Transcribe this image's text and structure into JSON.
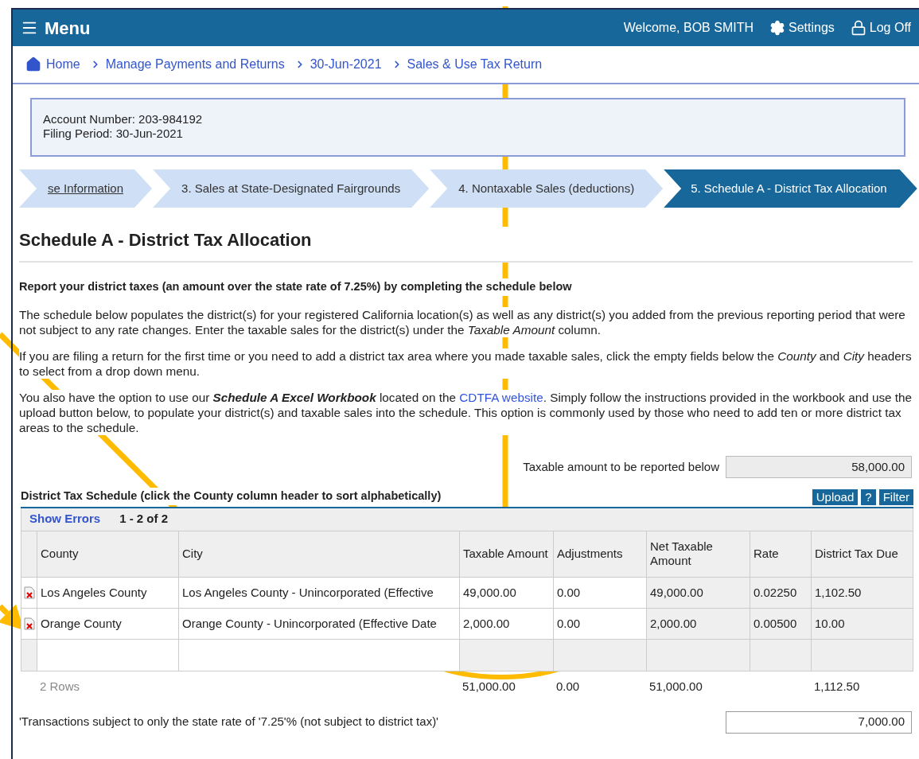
{
  "header": {
    "menu_label": "Menu",
    "welcome": "Welcome, BOB SMITH",
    "settings": "Settings",
    "logoff": "Log Off"
  },
  "breadcrumb": [
    "Home",
    "Manage Payments and Returns",
    "30-Jun-2021",
    "Sales & Use Tax Return"
  ],
  "account": {
    "number": "Account Number: 203-984192",
    "period": "Filing Period: 30-Jun-2021"
  },
  "steps": [
    {
      "label": "se Information",
      "kind": "link",
      "selected": false
    },
    {
      "label": "3. Sales at State-Designated Fairgrounds",
      "kind": "step",
      "selected": false
    },
    {
      "label": "4. Nontaxable Sales (deductions)",
      "kind": "step",
      "selected": false
    },
    {
      "label": "5. Schedule A - District Tax Allocation",
      "kind": "step",
      "selected": true
    }
  ],
  "heading": "Schedule A - District Tax Allocation",
  "intro": "Report your district taxes (an amount over the state rate of 7.25%) by completing the schedule below",
  "paragraphs": [
    [
      {
        "kind": "text",
        "text": "The schedule below populates the district(s) for your registered California location(s) as well as any district(s) you added from the previous reporting period that were not subject to any rate changes. Enter the taxable sales for the district(s) under the "
      },
      {
        "kind": "italic",
        "text": "Taxable Amount"
      },
      {
        "kind": "text",
        "text": " column."
      }
    ],
    [
      {
        "kind": "text",
        "text": "If you are filing a return for the first time or you need to add a district tax area where you made taxable sales, click the empty fields below the "
      },
      {
        "kind": "italic",
        "text": "County"
      },
      {
        "kind": "text",
        "text": " and "
      },
      {
        "kind": "italic",
        "text": "City"
      },
      {
        "kind": "text",
        "text": " headers to select from a drop down menu."
      }
    ],
    [
      {
        "kind": "text",
        "text": "You also have the option to use our "
      },
      {
        "kind": "bolditalic",
        "text": "Schedule A Excel Workbook"
      },
      {
        "kind": "text",
        "text": " located on the "
      },
      {
        "kind": "link",
        "text": "CDTFA website"
      },
      {
        "kind": "text",
        "text": ". Simply follow the instructions provided in the workbook and use the upload button below, to populate your district(s) and taxable sales into the schedule. This option is commonly used by those who need to add ten or more district tax areas to the schedule."
      }
    ]
  ],
  "taxable_summary": {
    "label": "Taxable amount to be reported below",
    "value": "58,000.00"
  },
  "schedule": {
    "title": "District Tax Schedule (click the County column header to sort alphabetically)",
    "buttons": [
      "Upload",
      "?",
      "Filter"
    ],
    "show_errors": "Show Errors",
    "range": "1 - 2 of 2",
    "columns": [
      "County",
      "City",
      "Taxable Amount",
      "Adjustments",
      "Net Taxable Amount",
      "Rate",
      "District Tax Due"
    ],
    "rows": [
      {
        "county": "Los Angeles County",
        "city": "Los Angeles County - Unincorporated (Effective",
        "taxable": "49,000.00",
        "adjustments": "0.00",
        "net": "49,000.00",
        "rate": "0.02250",
        "due": "1,102.50"
      },
      {
        "county": "Orange County",
        "city": "Orange County - Unincorporated (Effective Date",
        "taxable": "2,000.00",
        "adjustments": "0.00",
        "net": "2,000.00",
        "rate": "0.00500",
        "due": "10.00"
      }
    ],
    "footer": {
      "rows_label": "2 Rows",
      "taxable": "51,000.00",
      "adjustments": "0.00",
      "net": "51,000.00",
      "due": "1,112.50"
    }
  },
  "transactions": {
    "label": "'Transactions subject to only the state rate of '7.25'% (not subject to district tax)'",
    "value": "7,000.00"
  }
}
